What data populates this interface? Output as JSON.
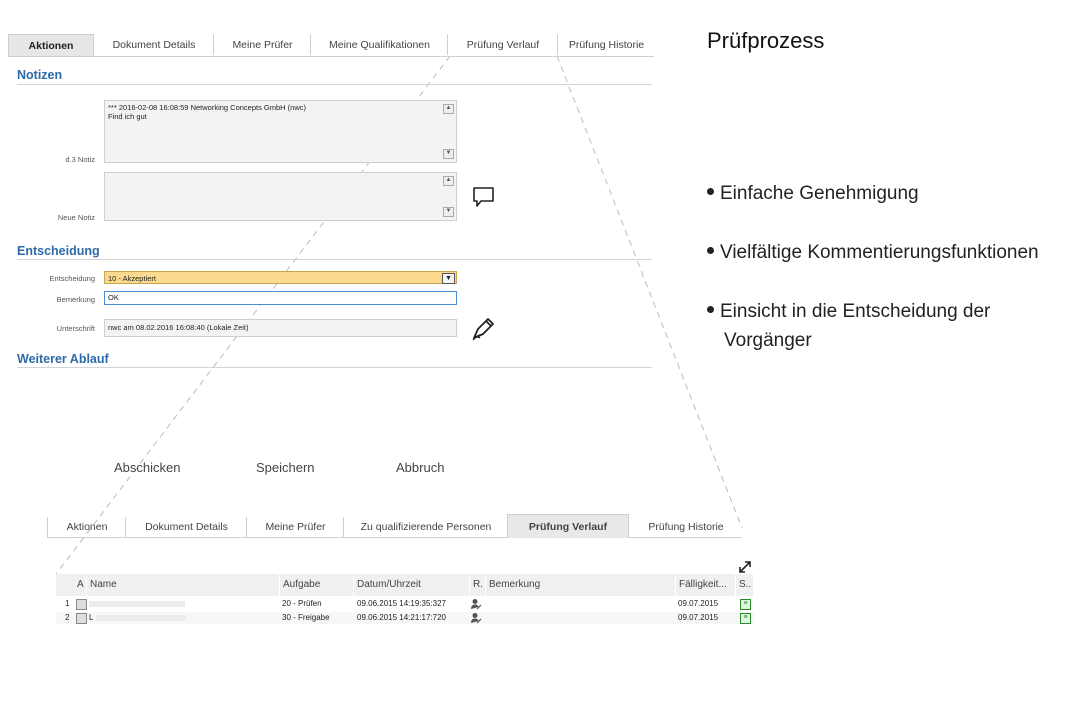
{
  "top_tabs": [
    "Aktionen",
    "Dokument Details",
    "Meine Prüfer",
    "Meine Qualifikationen",
    "Prüfung Verlauf",
    "Prüfung Historie"
  ],
  "sections": {
    "notizen": "Notizen",
    "entscheidung": "Entscheidung",
    "weiterer_ablauf": "Weiterer Ablauf"
  },
  "notes": {
    "d3_label": "d.3 Notiz",
    "d3_line1": "*** 2016-02-08 16:08:59 Networking Concepts GmbH (nwc)",
    "d3_line2": "Find ich gut",
    "new_label": "Neue Notiz",
    "new_value": ""
  },
  "decision": {
    "label": "Entscheidung",
    "value": "10 - Akzeptiert",
    "remark_label": "Bemerkung",
    "remark_value": "OK",
    "signature_label": "Unterschrift",
    "signature_value": "nwc am 08.02.2016 16:08:40 (Lokale Zeit)"
  },
  "actions": {
    "submit": "Abschicken",
    "save": "Speichern",
    "cancel": "Abbruch"
  },
  "bottom_tabs": [
    "Aktionen",
    "Dokument Details",
    "Meine Prüfer",
    "Zu qualifizierende Personen",
    "Prüfung Verlauf",
    "Prüfung Historie"
  ],
  "grid": {
    "headers": [
      "A",
      "Name",
      "Aufgabe",
      "Datum/Uhrzeit",
      "R.",
      "Bemerkung",
      "Fälligkeit...",
      "S.."
    ],
    "rows": [
      {
        "num": "1",
        "task": "20 - Prüfen",
        "datetime": "09.06.2015 14:19:35:327",
        "due": "09.07.2015"
      },
      {
        "num": "2",
        "name_prefix": "L",
        "task": "30 - Freigabe",
        "datetime": "09.06.2015 14:21:17:720",
        "due": "09.07.2015"
      }
    ]
  },
  "right": {
    "title": "Prüfprozess",
    "bullets": [
      "Einfache Genehmigung",
      "Vielfältige Kommentierungsfunktionen",
      "Einsicht in die Entscheidung der Vorgänger"
    ]
  },
  "colors": {
    "section_blue": "#2e6aa8",
    "select_bg": "#fbd98e",
    "input_border": "#4a8fd4"
  },
  "icons": {
    "comment": "comment-icon",
    "signature": "signature-pen-icon",
    "expand": "expand-icon",
    "reviewer": "person-edit-icon",
    "status": "status-ok-icon"
  }
}
